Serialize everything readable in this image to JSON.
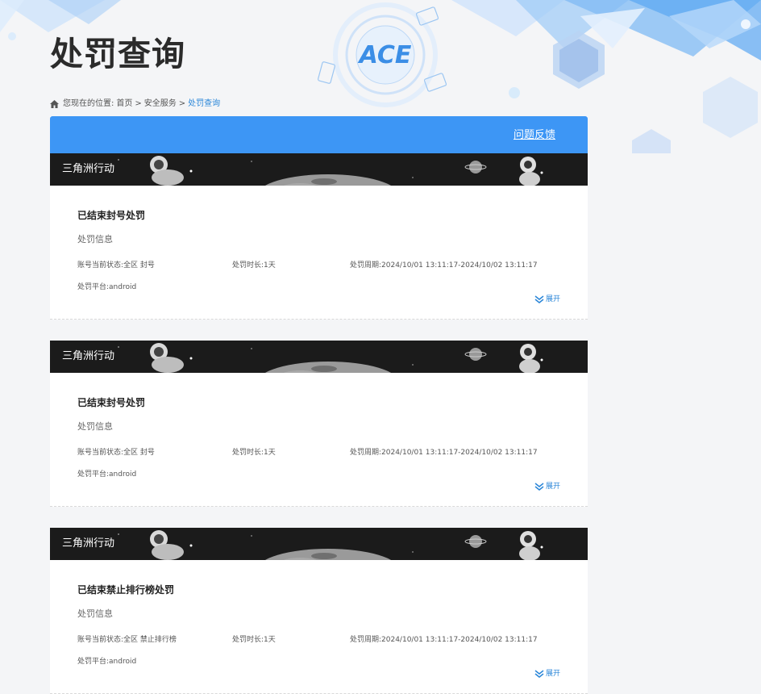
{
  "page": {
    "title": "处罚查询"
  },
  "breadcrumb": {
    "prefix": "您现在的位置:",
    "home": "首页",
    "sep1": ">",
    "section": "安全服务",
    "sep2": ">",
    "current": "处罚查询"
  },
  "logo_text": "ACE",
  "panel": {
    "feedback_label": "问题反馈"
  },
  "records": [
    {
      "game": "三角洲行动",
      "title": "已结束封号处罚",
      "subtitle": "处罚信息",
      "status": "账号当前状态:全区 封号",
      "duration": "处罚时长:1天",
      "period": "处罚周期:2024/10/01 13:11:17-2024/10/02 13:11:17",
      "platform": "处罚平台:android",
      "expand": "展开"
    },
    {
      "game": "三角洲行动",
      "title": "已结束封号处罚",
      "subtitle": "处罚信息",
      "status": "账号当前状态:全区 封号",
      "duration": "处罚时长:1天",
      "period": "处罚周期:2024/10/01 13:11:17-2024/10/02 13:11:17",
      "platform": "处罚平台:android",
      "expand": "展开"
    },
    {
      "game": "三角洲行动",
      "title": "已结束禁止排行榜处罚",
      "subtitle": "处罚信息",
      "status": "账号当前状态:全区 禁止排行榜",
      "duration": "处罚时长:1天",
      "period": "处罚周期:2024/10/01 13:11:17-2024/10/02 13:11:17",
      "platform": "处罚平台:android",
      "expand": "展开"
    }
  ],
  "colors": {
    "accent": "#3d96f5",
    "link": "#2a86d8",
    "banner_bg": "#1b1b1b",
    "page_bg": "#f4f5f7"
  },
  "icons": {
    "home": "home-icon",
    "expand": "double-chevron-down-icon",
    "logo": "ace-logo"
  }
}
